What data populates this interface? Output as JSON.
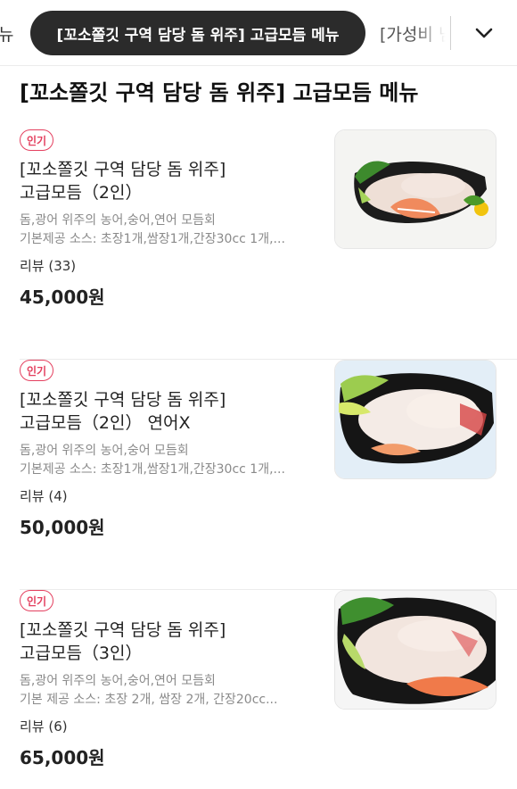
{
  "tabs": {
    "prev_label": "뉴",
    "active_label": "[꼬소쫄깃 구역 담당 돔 위주] 고급모듬 메뉴",
    "next_label": "[가성비 넘"
  },
  "icons": {
    "expand": "chevron-down-icon"
  },
  "section": {
    "title": "[꼬소쫄깃 구역 담당 돔 위주] 고급모듬 메뉴"
  },
  "menu": {
    "items": [
      {
        "badge": "인기",
        "name_line1": "[꼬소쫄깃 구역 담당 돔 위주]",
        "name_line2": "고급모듬（2인）",
        "desc_line1": "돔,광어 위주의 농어,숭어,연어 모듬회",
        "desc_line2": "기본제공 소스: 초장1개,쌈장1개,간장30cc 1개,...",
        "review": "리뷰 (33)",
        "price": "45,000원"
      },
      {
        "badge": "인기",
        "name_line1": "[꼬소쫄깃 구역 담당 돔 위주]",
        "name_line2": "고급모듬（2인） 연어X",
        "desc_line1": "돔,광어 위주의 농어,숭어 모듬회",
        "desc_line2": "기본제공 소스: 초장1개,쌈장1개,간장30cc 1개,...",
        "review": "리뷰 (4)",
        "price": "50,000원"
      },
      {
        "badge": "인기",
        "name_line1": "[꼬소쫄깃 구역 담당 돔 위주]",
        "name_line2": "고급모듬（3인）",
        "desc_line1": "돔,광어 위주의 농어,숭어,연어 모듬회",
        "desc_line2": "기본 제공 소스: 초장 2개, 쌈장 2개, 간장20cc...",
        "review": "리뷰 (6)",
        "price": "65,000원"
      }
    ]
  },
  "colors": {
    "accent": "#e4405f",
    "active_tab_bg": "#2b2b2b",
    "muted_text": "#8a8a8a"
  }
}
